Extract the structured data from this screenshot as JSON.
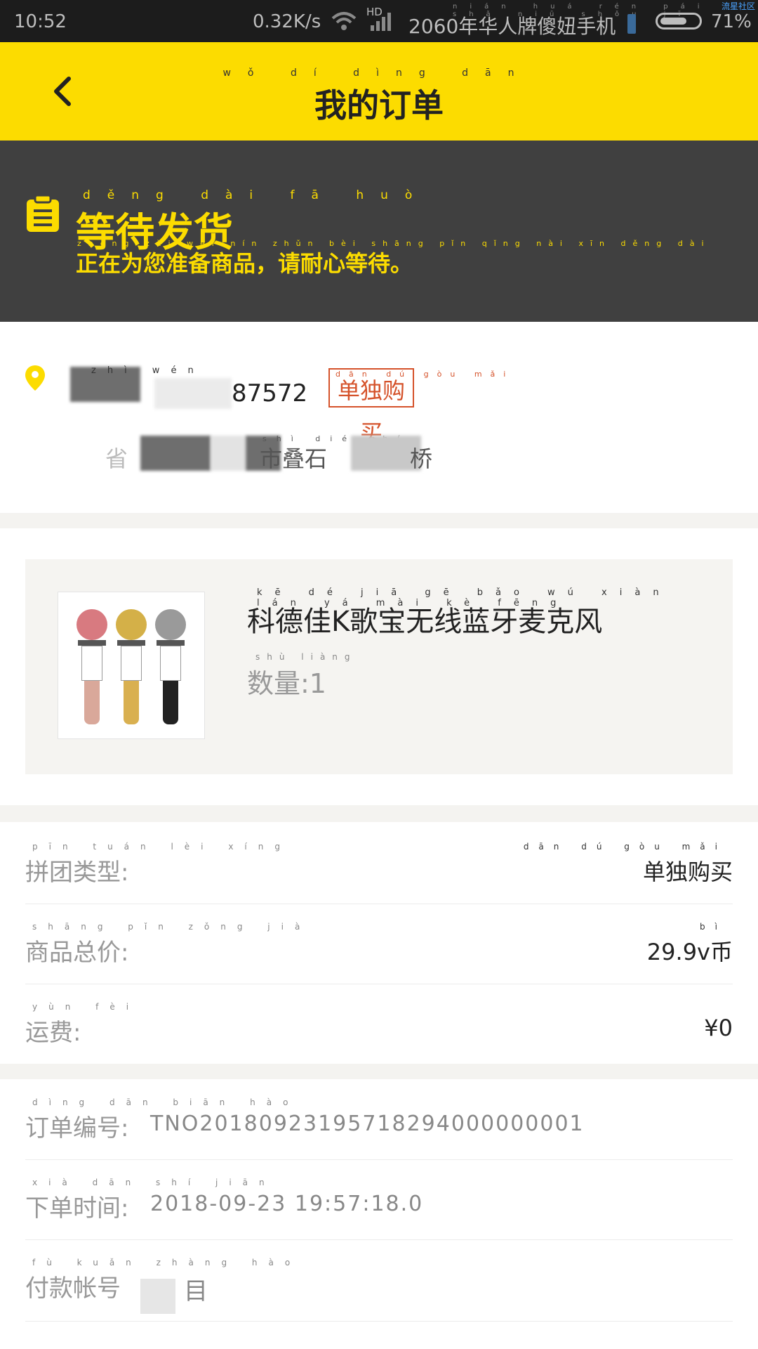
{
  "status_bar": {
    "time": "10:52",
    "speed": "0.32K/s",
    "hd": "HD",
    "carrier": "2060年华人牌傻妞手机",
    "carrier_ruby": "nián huá rén pái shǎ niū shǒu jī",
    "battery": "71%",
    "battery_level": 0.71,
    "community": "流星社区"
  },
  "header": {
    "title": "我的订单",
    "title_ruby": "wǒ dí dìng dān"
  },
  "order_status": {
    "title": "等待发货",
    "title_ruby": "děng dài fā huò",
    "subtitle": "正在为您准备商品，请耐心等待。",
    "subtitle_ruby": "zhèng zài wèi nín zhǔn bèi shāng pǐn qǐng nài xīn děng dài"
  },
  "address": {
    "name_ruby": "zhì wén",
    "phone": "87572",
    "tag": "单独购买",
    "tag_ruby": "dān dú gòu mǎi",
    "line_prefix": "省",
    "line_mid": "市叠石",
    "line_end": "桥",
    "line_ruby": "shì dié shí"
  },
  "product": {
    "name": "科德佳K歌宝无线蓝牙麦克风",
    "name_ruby": "kē dé jiā gē bǎo wú xiàn lán yá mài kè fēng",
    "quantity": "数量:1",
    "quantity_ruby": "shù liàng"
  },
  "summary": [
    {
      "label": "拼团类型:",
      "label_ruby": "pīn tuán lèi xíng",
      "value": "单独购买",
      "value_ruby": "dān dú gòu mǎi"
    },
    {
      "label": "商品总价:",
      "label_ruby": "shāng pǐn zǒng jià",
      "value": "29.9v币",
      "value_ruby": "bì"
    },
    {
      "label": "运费:",
      "label_ruby": "yùn fèi",
      "value": "¥0",
      "value_ruby": ""
    }
  ],
  "details": [
    {
      "label": "订单编号:",
      "label_ruby": "dìng dān biān hào",
      "value": "TNO20180923195718294000000001"
    },
    {
      "label": "下单时间:",
      "label_ruby": "xià dān shí jiān",
      "value": "2018-09-23 19:57:18.0"
    },
    {
      "label": "付款帐号",
      "label_ruby": "fù kuǎn zhàng hào",
      "value": "目"
    }
  ],
  "colors": {
    "accent_yellow": "#fcdc00",
    "banner_dark": "#404040",
    "tag_red": "#d5522a"
  }
}
